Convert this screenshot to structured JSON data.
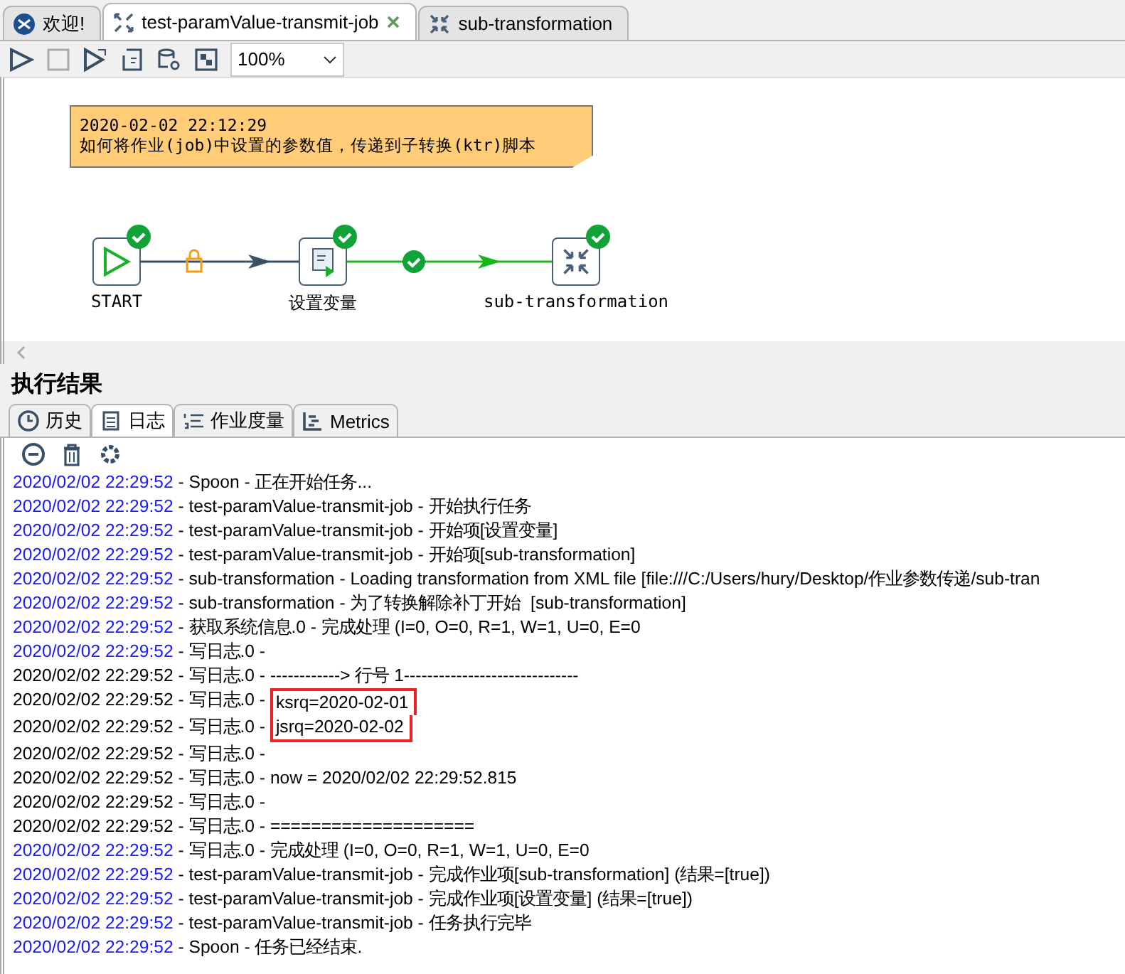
{
  "editor_tabs": [
    {
      "label": "欢迎!",
      "kind": "welcome",
      "selected": false,
      "closable": false
    },
    {
      "label": "test-paramValue-transmit-job",
      "kind": "job",
      "selected": true,
      "closable": true
    },
    {
      "label": "sub-transformation",
      "kind": "transformation",
      "selected": false,
      "closable": false
    }
  ],
  "toolbar": {
    "zoom": "100%"
  },
  "canvas": {
    "note": {
      "lines": [
        "2020-02-02 22:12:29",
        "如何将作业(job)中设置的参数值，传递到子转换(ktr)脚本"
      ]
    },
    "nodes": [
      {
        "label": "START",
        "kind": "start",
        "done": true
      },
      {
        "label": "设置变量",
        "kind": "script",
        "done": true
      },
      {
        "label": "sub-transformation",
        "kind": "transformation",
        "done": true
      }
    ],
    "hops": [
      {
        "kind": "unconditional"
      },
      {
        "kind": "success"
      }
    ]
  },
  "results": {
    "title": "执行结果",
    "tabs": [
      {
        "label": "历史",
        "kind": "history",
        "selected": false
      },
      {
        "label": "日志",
        "kind": "log",
        "selected": true
      },
      {
        "label": "作业度量",
        "kind": "metrics-list",
        "selected": false
      },
      {
        "label": "Metrics",
        "kind": "metrics",
        "selected": false
      }
    ],
    "log": [
      {
        "time": "2020/02/02 22:29:52",
        "text": " - Spoon - 正在开始任务...",
        "color": "#1a1aff",
        "highlighted": false
      },
      {
        "time": "2020/02/02 22:29:52",
        "text": " - test-paramValue-transmit-job - 开始执行任务",
        "color": "#1a1aff",
        "highlighted": false
      },
      {
        "time": "2020/02/02 22:29:52",
        "text": " - test-paramValue-transmit-job - 开始项[设置变量]",
        "color": "#1a1aff",
        "highlighted": false
      },
      {
        "time": "2020/02/02 22:29:52",
        "text": " - test-paramValue-transmit-job - 开始项[sub-transformation]",
        "color": "#1a1aff",
        "highlighted": false
      },
      {
        "time": "2020/02/02 22:29:52",
        "text": " - sub-transformation - Loading transformation from XML file [file:///C:/Users/hury/Desktop/作业参数传递/sub-tran",
        "color": "#1a1aff",
        "highlighted": false
      },
      {
        "time": "2020/02/02 22:29:52",
        "text": " - sub-transformation - 为了转换解除补丁开始  [sub-transformation]",
        "color": "#1a1aff",
        "highlighted": false
      },
      {
        "time": "2020/02/02 22:29:52",
        "text": " - 获取系统信息.0 - 完成处理 (I=0, O=0, R=1, W=1, U=0, E=0",
        "color": "#1a1aff",
        "highlighted": false
      },
      {
        "time": "2020/02/02 22:29:52",
        "text": " - 写日志.0 -",
        "color": "#1a1aff",
        "highlighted": false
      },
      {
        "time": "2020/02/02 22:29:52",
        "text": " - 写日志.0 - ------------> 行号 1------------------------------",
        "color": "#000000",
        "highlighted": false
      },
      {
        "time": "2020/02/02 22:29:52",
        "text": " - 写日志.0 - ",
        "highlight_text": "ksrq=2020-02-01",
        "color": "#000000",
        "highlighted": true
      },
      {
        "time": "2020/02/02 22:29:52",
        "text": " - 写日志.0 - ",
        "highlight_text": "jsrq=2020-02-02",
        "color": "#000000",
        "highlighted": true
      },
      {
        "time": "2020/02/02 22:29:52",
        "text": " - 写日志.0 -",
        "color": "#000000",
        "highlighted": false
      },
      {
        "time": "2020/02/02 22:29:52",
        "text": " - 写日志.0 - now = 2020/02/02 22:29:52.815",
        "color": "#000000",
        "highlighted": false
      },
      {
        "time": "2020/02/02 22:29:52",
        "text": " - 写日志.0 -",
        "color": "#000000",
        "highlighted": false
      },
      {
        "time": "2020/02/02 22:29:52",
        "text": " - 写日志.0 - ====================",
        "color": "#000000",
        "highlighted": false
      },
      {
        "time": "2020/02/02 22:29:52",
        "text": " - 写日志.0 - 完成处理 (I=0, O=0, R=1, W=1, U=0, E=0",
        "color": "#1a1aff",
        "highlighted": false
      },
      {
        "time": "2020/02/02 22:29:52",
        "text": " - test-paramValue-transmit-job - 完成作业项[sub-transformation] (结果=[true])",
        "color": "#1a1aff",
        "highlighted": false
      },
      {
        "time": "2020/02/02 22:29:52",
        "text": " - test-paramValue-transmit-job - 完成作业项[设置变量] (结果=[true])",
        "color": "#1a1aff",
        "highlighted": false
      },
      {
        "time": "2020/02/02 22:29:52",
        "text": " - test-paramValue-transmit-job - 任务执行完毕",
        "color": "#1a1aff",
        "highlighted": false
      },
      {
        "time": "2020/02/02 22:29:52",
        "text": " - Spoon - 任务已经结束.",
        "color": "#1a1aff",
        "highlighted": false
      }
    ]
  }
}
